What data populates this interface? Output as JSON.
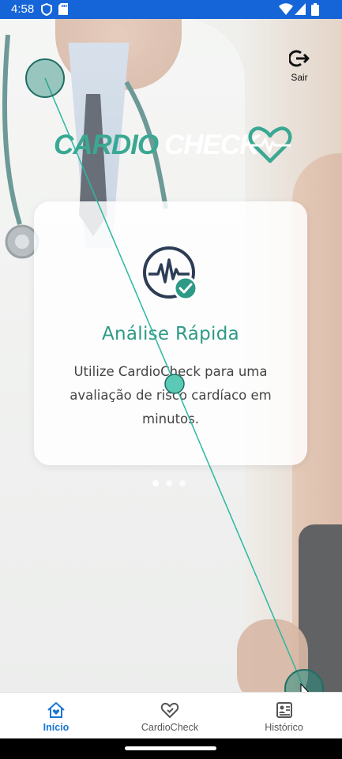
{
  "status_bar": {
    "time": "4:58",
    "bg_color": "#1565d8"
  },
  "header": {
    "logout_label": "Sair",
    "logout_icon": "logout-icon"
  },
  "logo": {
    "part1": "CARDIO",
    "part2": "CHECK",
    "accent_color": "#3aa892",
    "icon": "heart-pulse-icon"
  },
  "card": {
    "icon": "heart-monitor-check-icon",
    "title": "Análise Rápida",
    "description": "Utilize CardioCheck para uma avaliação de risco cardíaco em minutos.",
    "title_color": "#2e9a86"
  },
  "carousel": {
    "total": 3,
    "active": 1
  },
  "bottom_nav": {
    "items": [
      {
        "label": "Início",
        "icon": "home-heart-icon",
        "active": true
      },
      {
        "label": "CardioCheck",
        "icon": "heart-check-icon",
        "active": false
      },
      {
        "label": "Histórico",
        "icon": "history-report-icon",
        "active": false
      }
    ],
    "active_color": "#1976d2"
  }
}
